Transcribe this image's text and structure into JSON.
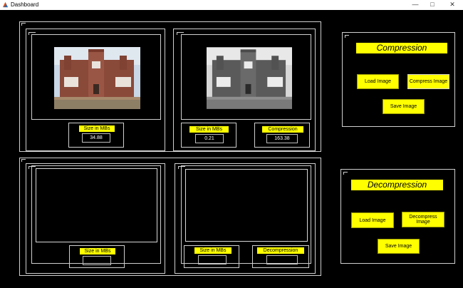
{
  "window": {
    "title": "Dashboard",
    "minimize": "—",
    "maximize": "□",
    "close": "✕"
  },
  "top": {
    "original": {
      "size_label": "Size in MBs",
      "size_value": "34.88"
    },
    "compressed": {
      "size_label": "Size in MBs",
      "size_value": "0.21",
      "ratio_label": "Compression Ratio",
      "ratio_value": "163.38"
    }
  },
  "bottom": {
    "left": {
      "size_label": "Size in MBs",
      "size_value": ""
    },
    "right": {
      "size_label": "Size in MBs",
      "size_value": "",
      "ratio_label": "Decompression Ratio",
      "ratio_value": ""
    }
  },
  "compression_panel": {
    "title": "Compression",
    "load": "Load Image",
    "compress": "Compress Image",
    "save": "Save Image"
  },
  "decompression_panel": {
    "title": "Decompression",
    "load": "Load Image",
    "decompress": "Decompress Image",
    "save": "Save Image"
  },
  "colors": {
    "accent": "#ffff00",
    "background": "#000000",
    "frame": "#cfcfcf"
  }
}
